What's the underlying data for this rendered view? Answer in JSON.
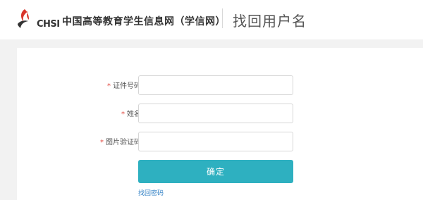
{
  "header": {
    "logo_text": "CHSI",
    "site_name": "中国高等教育学生信息网（学信网）",
    "page_title": "找回用户名"
  },
  "form": {
    "required_mark": "*",
    "fields": [
      {
        "label": "证件号码",
        "value": "",
        "placeholder": ""
      },
      {
        "label": "姓名",
        "value": "",
        "placeholder": ""
      },
      {
        "label": "图片验证码",
        "value": "",
        "placeholder": ""
      }
    ],
    "submit_label": "确定",
    "recover_password_link": "找回密码"
  },
  "colors": {
    "accent_button": "#2eb0c0",
    "link": "#2f7fc4",
    "required": "#e0463d",
    "logo_red": "#d9342b"
  }
}
